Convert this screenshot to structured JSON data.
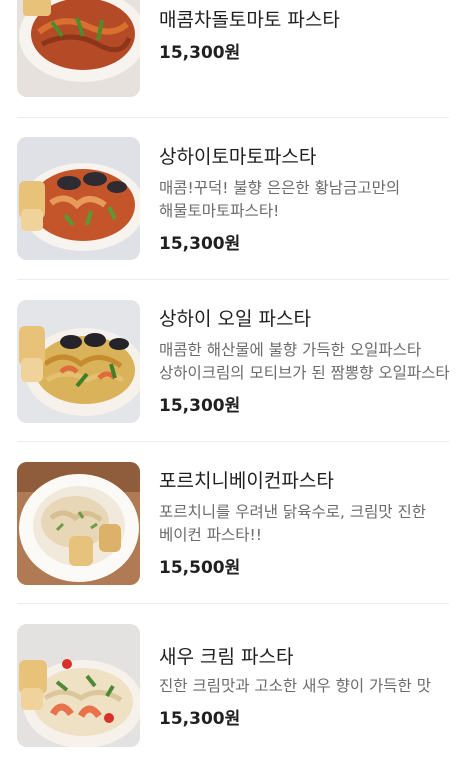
{
  "menu": {
    "items": [
      {
        "name": "매콤차돌토마토 파스타",
        "description": "",
        "price": "15,300원",
        "image_icon": "tomato-pasta-photo"
      },
      {
        "name": "상하이토마토파스타",
        "description": "매콤!꾸덕! 불향 은은한 황남금고만의 해물토마토파스타!",
        "price": "15,300원",
        "image_icon": "seafood-tomato-pasta-photo"
      },
      {
        "name": "상하이 오일 파스타",
        "description": "매콤한 해산물에 불향 가득한 오일파스타 상하이크림의 모티브가 된 짬뽕향 오일파스타",
        "price": "15,300원",
        "image_icon": "seafood-oil-pasta-photo"
      },
      {
        "name": "포르치니베이컨파스타",
        "description": "포르치니를 우려낸 닭육수로, 크림맛 진한 베이컨 파스타!!",
        "price": "15,500원",
        "image_icon": "porcini-bacon-pasta-photo"
      },
      {
        "name": "새우 크림 파스타",
        "description": "진한 크림맛과 고소한 새우 향이 가득한 맛",
        "price": "15,300원",
        "image_icon": "shrimp-cream-pasta-photo"
      }
    ]
  },
  "colors": {
    "text_primary": "#1f1f1f",
    "text_secondary": "#6b6b6b",
    "divider": "#ececec"
  }
}
